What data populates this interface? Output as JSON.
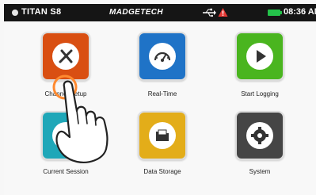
{
  "status_bar": {
    "device_name": "TITAN S8",
    "brand": "MADGETECH",
    "time": "08:36 AM",
    "icons": {
      "status_dot": "status-dot-icon",
      "usb": "usb-icon",
      "alert": "alert-icon",
      "battery": "battery-icon"
    },
    "colors": {
      "background": "#151515",
      "battery": "#24c24a",
      "alert": "#e53935"
    }
  },
  "menu": [
    {
      "id": "channel-setup",
      "label": "Channel Setup",
      "icon": "channel-setup-icon",
      "color": "#d94f12"
    },
    {
      "id": "real-time",
      "label": "Real-Time",
      "icon": "speedometer-icon",
      "color": "#1f73c7"
    },
    {
      "id": "start-logging",
      "label": "Start Logging",
      "icon": "play-icon",
      "color": "#4ab51f"
    },
    {
      "id": "current-session",
      "label": "Current Session",
      "icon": "graph-icon",
      "color": "#1fa7b8"
    },
    {
      "id": "data-storage",
      "label": "Data Storage",
      "icon": "folder-icon",
      "color": "#e3ad19"
    },
    {
      "id": "system",
      "label": "System",
      "icon": "gear-icon",
      "color": "#454545"
    }
  ]
}
